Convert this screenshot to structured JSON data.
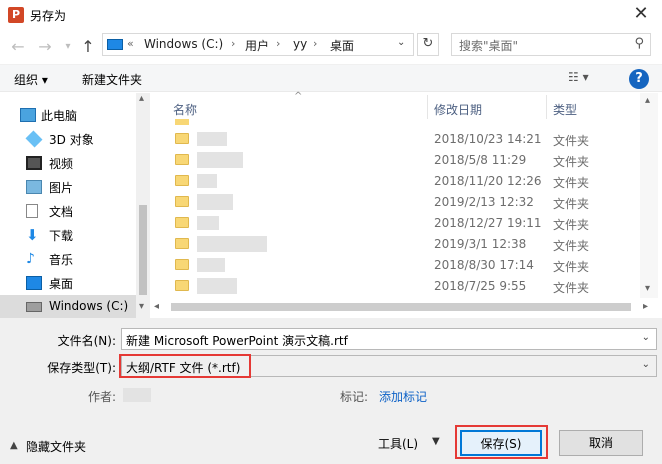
{
  "window": {
    "title": "另存为",
    "app_icon": "powerpoint-icon",
    "close_label": "✕"
  },
  "nav": {
    "back_icon": "back-arrow-icon",
    "forward_icon": "forward-arrow-icon",
    "recent_icon": "recent-dropdown-icon",
    "up_icon": "up-arrow-icon",
    "breadcrumb_overflow": "«",
    "breadcrumb": [
      "Windows (C:)",
      "用户",
      "yy",
      "桌面"
    ],
    "breadcrumb_sep": "›",
    "search_placeholder": "搜索\"桌面\""
  },
  "toolbar": {
    "organize_label": "组织 ▾",
    "new_folder_label": "新建文件夹",
    "view_icon": "view-options-icon",
    "help_label": "?"
  },
  "sidebar": {
    "items": [
      {
        "label": "此电脑",
        "icon": "this-pc-icon",
        "selected": false
      },
      {
        "label": "3D 对象",
        "icon": "3d-objects-icon",
        "selected": false
      },
      {
        "label": "视频",
        "icon": "video-icon",
        "selected": false
      },
      {
        "label": "图片",
        "icon": "pictures-icon",
        "selected": false
      },
      {
        "label": "文档",
        "icon": "documents-icon",
        "selected": false
      },
      {
        "label": "下载",
        "icon": "downloads-icon",
        "selected": false
      },
      {
        "label": "音乐",
        "icon": "music-icon",
        "selected": false
      },
      {
        "label": "桌面",
        "icon": "desktop-icon",
        "selected": false
      },
      {
        "label": "Windows (C:)",
        "icon": "drive-icon",
        "selected": true
      }
    ]
  },
  "filelist": {
    "columns": {
      "name": "名称",
      "modified": "修改日期",
      "type": "类型"
    },
    "rows": [
      {
        "date": "2018/10/23 14:21",
        "type": "文件夹"
      },
      {
        "date": "2018/5/8 11:29",
        "type": "文件夹"
      },
      {
        "date": "2018/11/20 12:26",
        "type": "文件夹"
      },
      {
        "date": "2019/2/13 12:32",
        "type": "文件夹"
      },
      {
        "date": "2018/12/27 19:11",
        "type": "文件夹"
      },
      {
        "date": "2019/3/1 12:38",
        "type": "文件夹"
      },
      {
        "date": "2018/8/30 17:14",
        "type": "文件夹"
      },
      {
        "date": "2018/7/25 9:55",
        "type": "文件夹"
      }
    ]
  },
  "form": {
    "filename_label": "文件名(N):",
    "filename_value": "新建 Microsoft PowerPoint 演示文稿.rtf",
    "filetype_label": "保存类型(T):",
    "filetype_value": "大纲/RTF 文件 (*.rtf)",
    "author_label": "作者:",
    "tags_label": "标记:",
    "tags_value": "添加标记"
  },
  "footer": {
    "hide_folders_label": "隐藏文件夹",
    "tools_label": "工具(L)",
    "save_label": "保存(S)",
    "cancel_label": "取消"
  },
  "colors": {
    "accent": "#0078d7",
    "highlight_box": "#e53935",
    "link": "#0e62c7",
    "folder": "#f8d775"
  }
}
